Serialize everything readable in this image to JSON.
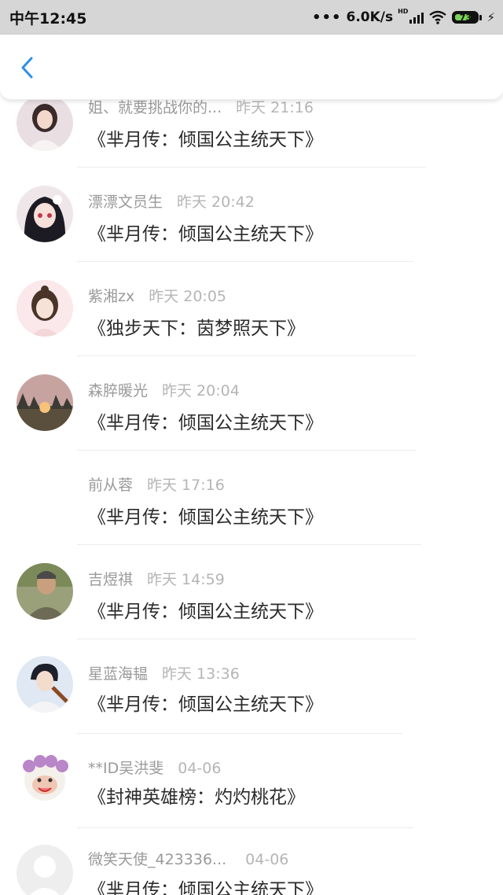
{
  "status_bar": {
    "time": "中午12:45",
    "network_speed": "6.0K/s",
    "hd_label": "HD",
    "battery": "73"
  },
  "header": {
    "back_icon": "chevron-left-icon",
    "accent": "#2f8fe6"
  },
  "items": [
    {
      "name": "姐、就要挑战你的...",
      "time": "昨天 21:16",
      "book": "《芈月传：倾国公主统天下》"
    },
    {
      "name": "漂漂文员生",
      "time": "昨天 20:42",
      "book": "《芈月传：倾国公主统天下》"
    },
    {
      "name": "紫湘zx",
      "time": "昨天 20:05",
      "book": "《独步天下：茵梦照天下》"
    },
    {
      "name": "森脺暖光",
      "time": "昨天 20:04",
      "book": "《芈月传：倾国公主统天下》"
    },
    {
      "name": "前从蓉",
      "time": "昨天 17:16",
      "book": "《芈月传：倾国公主统天下》"
    },
    {
      "name": "吉煜祺",
      "time": "昨天 14:59",
      "book": "《芈月传：倾国公主统天下》"
    },
    {
      "name": "星蓝海韫",
      "time": "昨天 13:36",
      "book": "《芈月传：倾国公主统天下》"
    },
    {
      "name": "**ID吴洪斐",
      "time": "04-06",
      "book": "《封神英雄榜：灼灼桃花》"
    },
    {
      "name": "微笑天使_423336...",
      "time": "04-06",
      "book": "《芈月传：倾国公主统天下》"
    }
  ]
}
